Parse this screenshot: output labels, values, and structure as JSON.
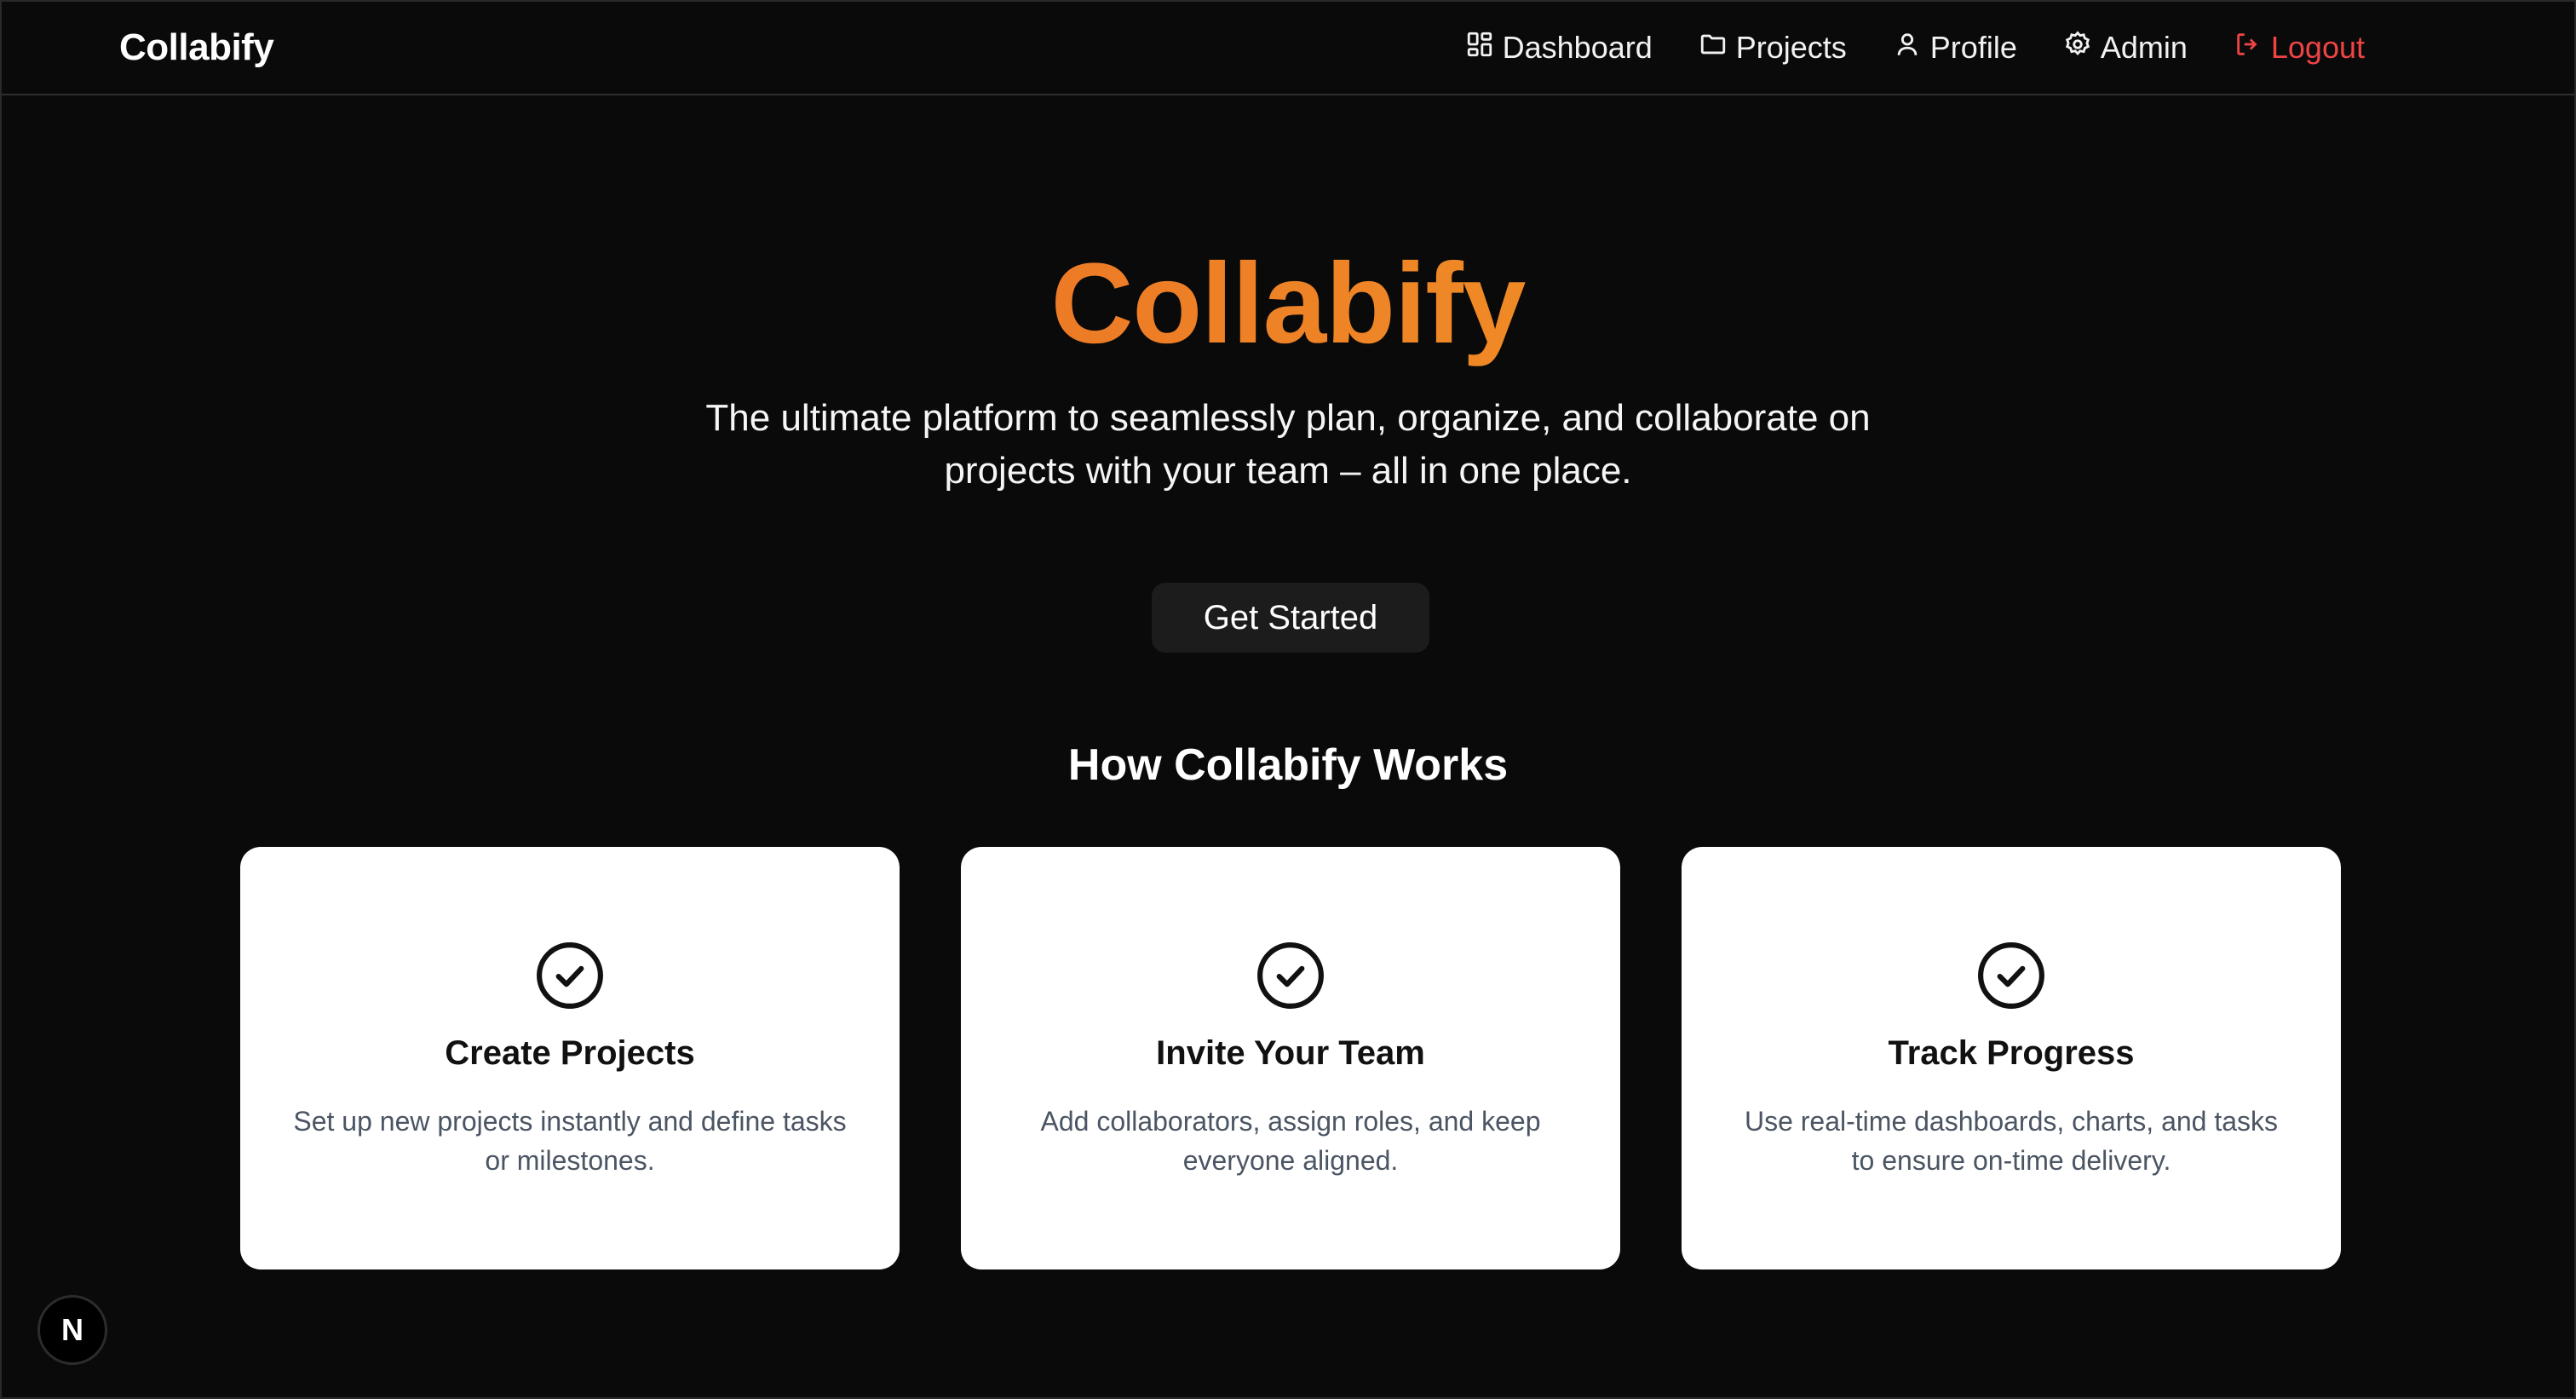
{
  "navbar": {
    "brand": "Collabify",
    "links": [
      {
        "label": "Dashboard",
        "icon": "dashboard-grid-icon"
      },
      {
        "label": "Projects",
        "icon": "folder-icon"
      },
      {
        "label": "Profile",
        "icon": "user-icon"
      },
      {
        "label": "Admin",
        "icon": "gear-icon"
      },
      {
        "label": "Logout",
        "icon": "logout-icon"
      }
    ]
  },
  "hero": {
    "title": "Collabify",
    "subtitle": "The ultimate platform to seamlessly plan, organize, and collaborate on projects with your team – all in one place.",
    "cta_label": "Get Started"
  },
  "features": {
    "heading": "How Collabify Works",
    "cards": [
      {
        "title": "Create Projects",
        "description": "Set up new projects instantly and define tasks or milestones.",
        "icon": "check-circle-icon"
      },
      {
        "title": "Invite Your Team",
        "description": "Add collaborators, assign roles, and keep everyone aligned.",
        "icon": "check-circle-icon"
      },
      {
        "title": "Track Progress",
        "description": "Use real-time dashboards, charts, and tasks to ensure on-time delivery.",
        "icon": "check-circle-icon"
      }
    ]
  },
  "badge": {
    "label": "N"
  },
  "colors": {
    "background": "#0a0a0a",
    "accent_start": "#e85a2a",
    "accent_end": "#f0a028",
    "logout": "#ef4444",
    "card_bg": "#ffffff"
  }
}
